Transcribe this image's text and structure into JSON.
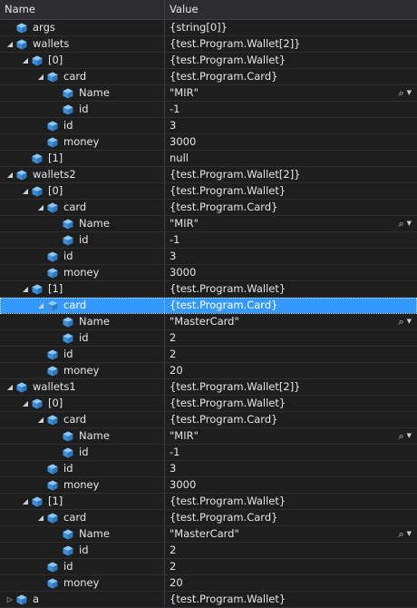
{
  "header": {
    "name": "Name",
    "value": "Value"
  },
  "rows": [
    {
      "depth": 0,
      "exp": "none",
      "name": "args",
      "value": "{string[0]}"
    },
    {
      "depth": 0,
      "exp": "open",
      "name": "wallets",
      "value": "{test.Program.Wallet[2]}"
    },
    {
      "depth": 1,
      "exp": "open",
      "name": "[0]",
      "value": "{test.Program.Wallet}"
    },
    {
      "depth": 2,
      "exp": "open",
      "name": "card",
      "value": "{test.Program.Card}"
    },
    {
      "depth": 3,
      "exp": "none",
      "name": "Name",
      "value": "\"MIR\"",
      "tools": true
    },
    {
      "depth": 3,
      "exp": "none",
      "name": "id",
      "value": "-1"
    },
    {
      "depth": 2,
      "exp": "none",
      "name": "id",
      "value": "3"
    },
    {
      "depth": 2,
      "exp": "none",
      "name": "money",
      "value": "3000"
    },
    {
      "depth": 1,
      "exp": "none",
      "name": "[1]",
      "value": "null"
    },
    {
      "depth": 0,
      "exp": "open",
      "name": "wallets2",
      "value": "{test.Program.Wallet[2]}"
    },
    {
      "depth": 1,
      "exp": "open",
      "name": "[0]",
      "value": "{test.Program.Wallet}"
    },
    {
      "depth": 2,
      "exp": "open",
      "name": "card",
      "value": "{test.Program.Card}"
    },
    {
      "depth": 3,
      "exp": "none",
      "name": "Name",
      "value": "\"MIR\"",
      "tools": true
    },
    {
      "depth": 3,
      "exp": "none",
      "name": "id",
      "value": "-1"
    },
    {
      "depth": 2,
      "exp": "none",
      "name": "id",
      "value": "3"
    },
    {
      "depth": 2,
      "exp": "none",
      "name": "money",
      "value": "3000"
    },
    {
      "depth": 1,
      "exp": "open",
      "name": "[1]",
      "value": "{test.Program.Wallet}"
    },
    {
      "depth": 2,
      "exp": "open",
      "name": "card",
      "value": "{test.Program.Card}",
      "selected": true
    },
    {
      "depth": 3,
      "exp": "none",
      "name": "Name",
      "value": "\"MasterCard\"",
      "tools": true
    },
    {
      "depth": 3,
      "exp": "none",
      "name": "id",
      "value": "2"
    },
    {
      "depth": 2,
      "exp": "none",
      "name": "id",
      "value": "2"
    },
    {
      "depth": 2,
      "exp": "none",
      "name": "money",
      "value": "20"
    },
    {
      "depth": 0,
      "exp": "open",
      "name": "wallets1",
      "value": "{test.Program.Wallet[2]}"
    },
    {
      "depth": 1,
      "exp": "open",
      "name": "[0]",
      "value": "{test.Program.Wallet}"
    },
    {
      "depth": 2,
      "exp": "open",
      "name": "card",
      "value": "{test.Program.Card}"
    },
    {
      "depth": 3,
      "exp": "none",
      "name": "Name",
      "value": "\"MIR\"",
      "tools": true
    },
    {
      "depth": 3,
      "exp": "none",
      "name": "id",
      "value": "-1"
    },
    {
      "depth": 2,
      "exp": "none",
      "name": "id",
      "value": "3"
    },
    {
      "depth": 2,
      "exp": "none",
      "name": "money",
      "value": "3000"
    },
    {
      "depth": 1,
      "exp": "open",
      "name": "[1]",
      "value": "{test.Program.Wallet}"
    },
    {
      "depth": 2,
      "exp": "open",
      "name": "card",
      "value": "{test.Program.Card}"
    },
    {
      "depth": 3,
      "exp": "none",
      "name": "Name",
      "value": "\"MasterCard\"",
      "tools": true
    },
    {
      "depth": 3,
      "exp": "none",
      "name": "id",
      "value": "2"
    },
    {
      "depth": 2,
      "exp": "none",
      "name": "id",
      "value": "2"
    },
    {
      "depth": 2,
      "exp": "none",
      "name": "money",
      "value": "20"
    },
    {
      "depth": 0,
      "exp": "closed",
      "name": "a",
      "value": "{test.Program.Wallet}"
    }
  ],
  "icons": {
    "field": "cube-field-icon",
    "search": "magnifier-icon",
    "dropdown": "chevron-down-icon"
  },
  "colors": {
    "background": "#1e1e1e",
    "icon": "#5fa9e6",
    "selected": "#3399ff"
  }
}
